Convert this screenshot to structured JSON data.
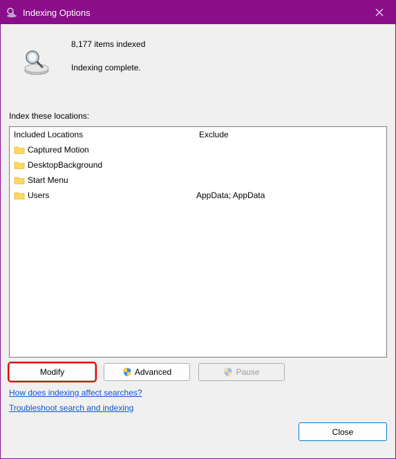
{
  "window": {
    "title": "Indexing Options"
  },
  "status": {
    "count_line": "8,177 items indexed",
    "message": "Indexing complete."
  },
  "section_label": "Index these locations:",
  "columns": {
    "included": "Included Locations",
    "exclude": "Exclude"
  },
  "rows": [
    {
      "name": "Captured Motion",
      "exclude": ""
    },
    {
      "name": "DesktopBackground",
      "exclude": ""
    },
    {
      "name": "Start Menu",
      "exclude": ""
    },
    {
      "name": "Users",
      "exclude": "AppData; AppData"
    }
  ],
  "buttons": {
    "modify": "Modify",
    "advanced": "Advanced",
    "pause": "Pause",
    "close": "Close"
  },
  "links": {
    "how": "How does indexing affect searches?",
    "troubleshoot": "Troubleshoot search and indexing"
  }
}
